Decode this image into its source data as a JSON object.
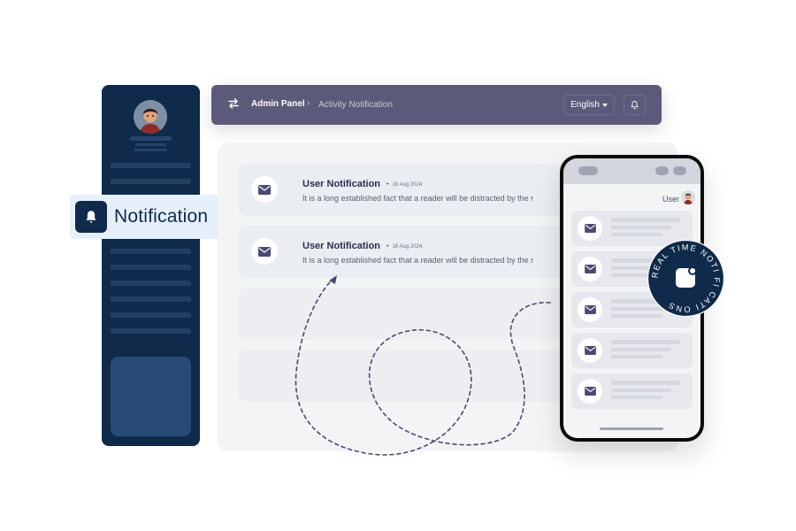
{
  "topbar": {
    "app": "Admin Panel",
    "separator": "›",
    "page": "Activity Notification",
    "language": "English"
  },
  "sidebar": {
    "badge_label": "Notification"
  },
  "notifications": [
    {
      "title": "User Notification",
      "date": "16 Aug 2024",
      "body": "It is a long established fact that a reader will be distracted by the r"
    },
    {
      "title": "User Notification",
      "date": "16 Aug 2024",
      "body": "It is a long established fact that a reader will be distracted by the r"
    }
  ],
  "phone": {
    "user_label": "User"
  },
  "badge": {
    "text": "REAL TIME NOTI FI CATI ONS"
  },
  "colors": {
    "navy": "#0f2a4a",
    "topbar": "#5c5a7a",
    "accent_text": "#2e2b53",
    "panel": "#f3f4f6"
  },
  "icons": [
    "swap-arrows-icon",
    "bell-icon",
    "mail-icon",
    "chevron-down-icon",
    "app-icon"
  ]
}
